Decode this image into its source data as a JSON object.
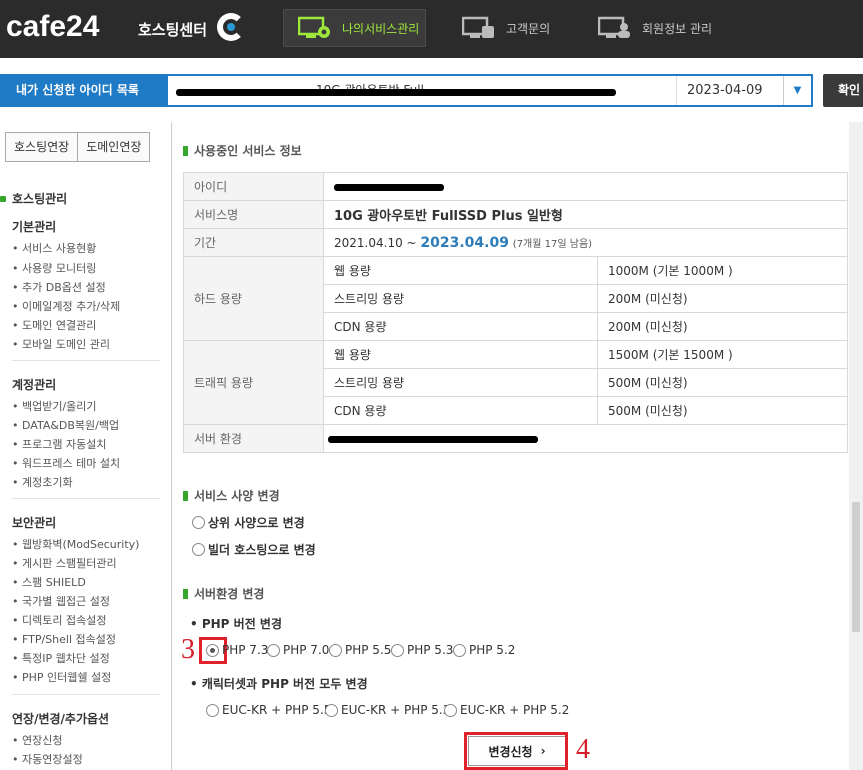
{
  "header": {
    "logo": "cafe24",
    "logo_sub": "호스팅센터",
    "nav": [
      {
        "label": "나의서비스관리",
        "icon": "monitor-gear-icon"
      },
      {
        "label": "고객문의",
        "icon": "monitor-chat-icon"
      },
      {
        "label": "회원정보 관리",
        "icon": "monitor-user-icon"
      }
    ]
  },
  "idbar": {
    "label": "내가 신청한 아이디 목록",
    "selected_text": "10G 광아우토반 Full",
    "date": "2023-04-09",
    "confirm": "확인"
  },
  "sidebar": {
    "buttons": [
      "호스팅연장",
      "도메인연장"
    ],
    "title": "호스팅관리",
    "groups": [
      {
        "name": "기본관리",
        "items": [
          "서비스 사용현황",
          "사용량 모니터링",
          "추가 DB옵션 설정",
          "이메일계정 추가/삭제",
          "도메인 연결관리",
          "모바일 도메인 관리"
        ]
      },
      {
        "name": "계정관리",
        "items": [
          "백업받기/올리기",
          "DATA&DB복원/백업",
          "프로그램 자동설치",
          "워드프레스 테마 설치",
          "계정초기화"
        ]
      },
      {
        "name": "보안관리",
        "items": [
          "웹방화벽(ModSecurity)",
          "게시판 스팸필터관리",
          "스팸 SHIELD",
          "국가별 웹접근 설정",
          "디렉토리 접속설정",
          "FTP/Shell 접속설정",
          "특정IP 웹차단 설정",
          "PHP 인터웹쉘 설정"
        ]
      },
      {
        "name": "연장/변경/추가옵션",
        "items": [
          "연장신청",
          "자동연장설정"
        ]
      }
    ]
  },
  "service_info": {
    "title": "사용중인 서비스 정보",
    "id_label": "아이디",
    "service_label": "서비스명",
    "service_name": "10G 광아우토반 FullSSD Plus 일반형",
    "period_label": "기간",
    "period_start": "2021.04.10 ~ ",
    "period_end": "2023.04.09",
    "period_remain": "(7개월 17일 남음)",
    "disk_label": "하드 용량",
    "disk_rows": [
      {
        "name": "웹 용량",
        "value": "1000M (기본 1000M )"
      },
      {
        "name": "스트리밍 용량",
        "value": "200M (미신청)"
      },
      {
        "name": "CDN 용량",
        "value": "200M (미신청)"
      }
    ],
    "traffic_label": "트래픽 용량",
    "traffic_rows": [
      {
        "name": "웹 용량",
        "value": "1500M (기본 1500M )"
      },
      {
        "name": "스트리밍 용량",
        "value": "500M (미신청)"
      },
      {
        "name": "CDN 용량",
        "value": "500M (미신청)"
      }
    ],
    "env_label": "서버 환경"
  },
  "spec_change": {
    "title": "서비스 사양 변경",
    "options": [
      "상위 사양으로 변경",
      "빌더 호스팅으로 변경"
    ]
  },
  "env_change": {
    "title": "서버환경 변경",
    "php_title": "• PHP 버전 변경",
    "php_options": [
      "PHP 7.3",
      "PHP 7.0",
      "PHP 5.5",
      "PHP 5.3",
      "PHP 5.2"
    ],
    "php_selected": "PHP 7.3",
    "charset_title": "• 캐릭터셋과 PHP 버전 모두 변경",
    "charset_options": [
      "EUC-KR + PHP 5.5",
      "EUC-KR + PHP 5.3",
      "EUC-KR + PHP 5.2"
    ],
    "apply": "변경신청",
    "apply_arrow": "›"
  },
  "annotations": {
    "step3": "3",
    "step4": "4"
  },
  "colors": {
    "brand_blue": "#1f7bc6",
    "accent_green": "#9ee83c",
    "highlight_red": "#e0202a"
  }
}
